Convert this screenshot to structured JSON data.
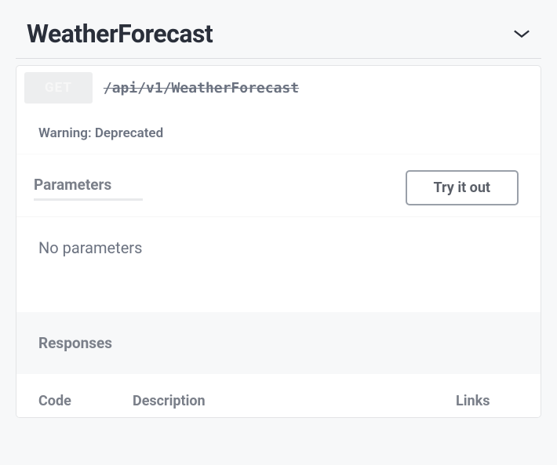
{
  "section": {
    "title": "WeatherForecast"
  },
  "endpoint": {
    "method": "GET",
    "path": "/api/v1/WeatherForecast",
    "deprecated_warning": "Warning: Deprecated"
  },
  "parameters": {
    "heading": "Parameters",
    "try_button": "Try it out",
    "empty_text": "No parameters"
  },
  "responses": {
    "heading": "Responses",
    "columns": {
      "code": "Code",
      "description": "Description",
      "links": "Links"
    }
  }
}
